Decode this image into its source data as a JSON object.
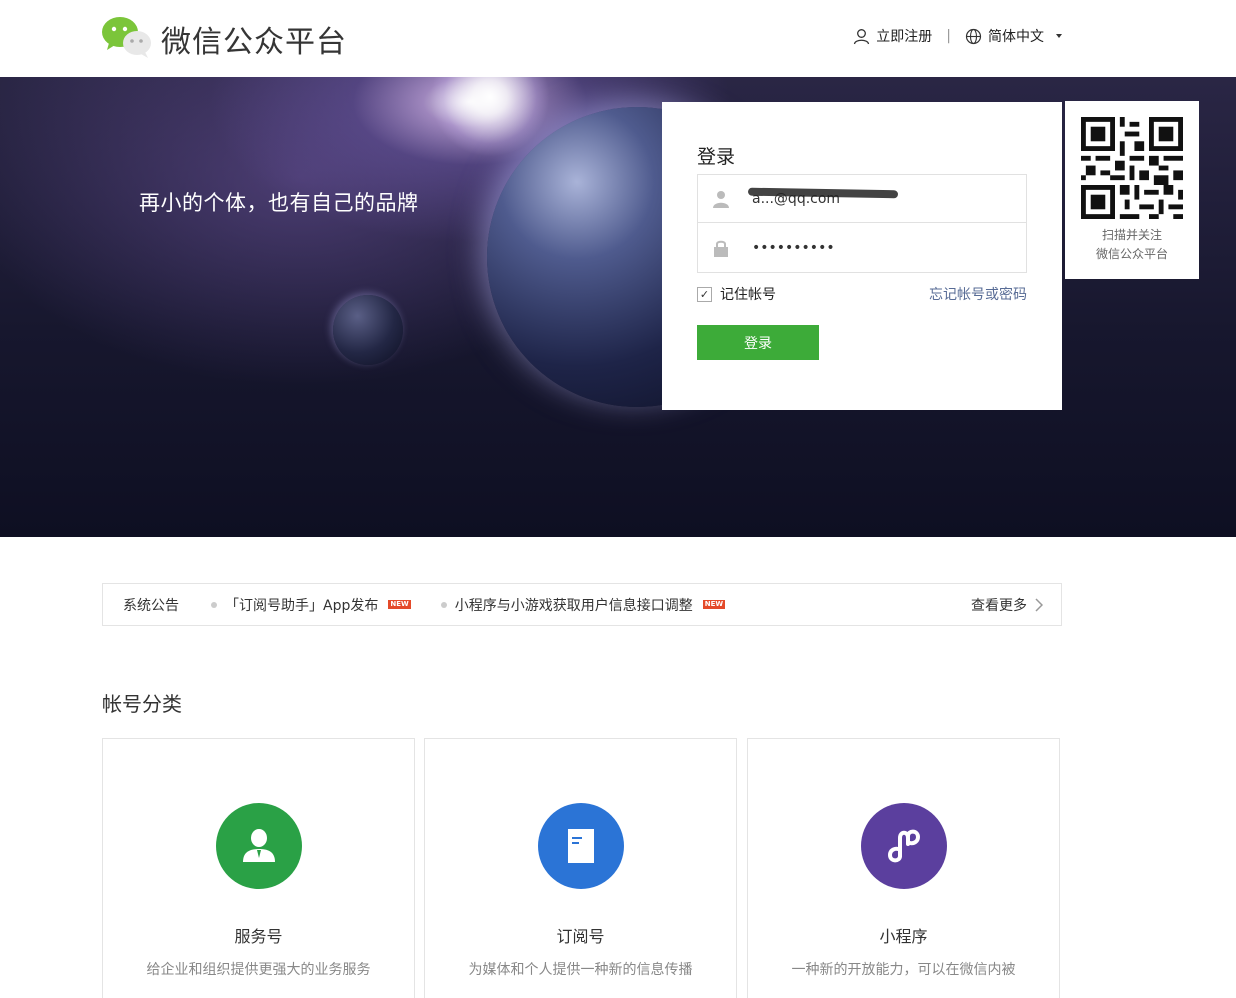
{
  "header": {
    "brand": "微信公众平台",
    "register": "立即注册",
    "separator": "|",
    "language": "简体中文"
  },
  "banner": {
    "slogan": "再小的个体，也有自己的品牌"
  },
  "login": {
    "title": "登录",
    "account_value": "a...@qq.com",
    "password_value": "••••••••••",
    "remember_label": "记住帐号",
    "remember_checked": true,
    "forgot_label": "忘记帐号或密码",
    "submit_label": "登录",
    "button_color": "#3dab39"
  },
  "qr": {
    "line1": "扫描并关注",
    "line2": "微信公众平台"
  },
  "notice": {
    "label": "系统公告",
    "items": [
      {
        "text": "「订阅号助手」App发布",
        "badge": "NEW"
      },
      {
        "text": "小程序与小游戏获取用户信息接口调整",
        "badge": "NEW"
      }
    ],
    "more": "查看更多"
  },
  "categories": {
    "title": "帐号分类",
    "items": [
      {
        "name": "服务号",
        "desc": "给企业和组织提供更强大的业务服务",
        "color": "#2aa146",
        "icon": "person-icon"
      },
      {
        "name": "订阅号",
        "desc": "为媒体和个人提供一种新的信息传播",
        "color": "#2b74d6",
        "icon": "document-icon"
      },
      {
        "name": "小程序",
        "desc": "一种新的开放能力，可以在微信内被",
        "color": "#5b3f9e",
        "icon": "link-icon"
      }
    ]
  }
}
